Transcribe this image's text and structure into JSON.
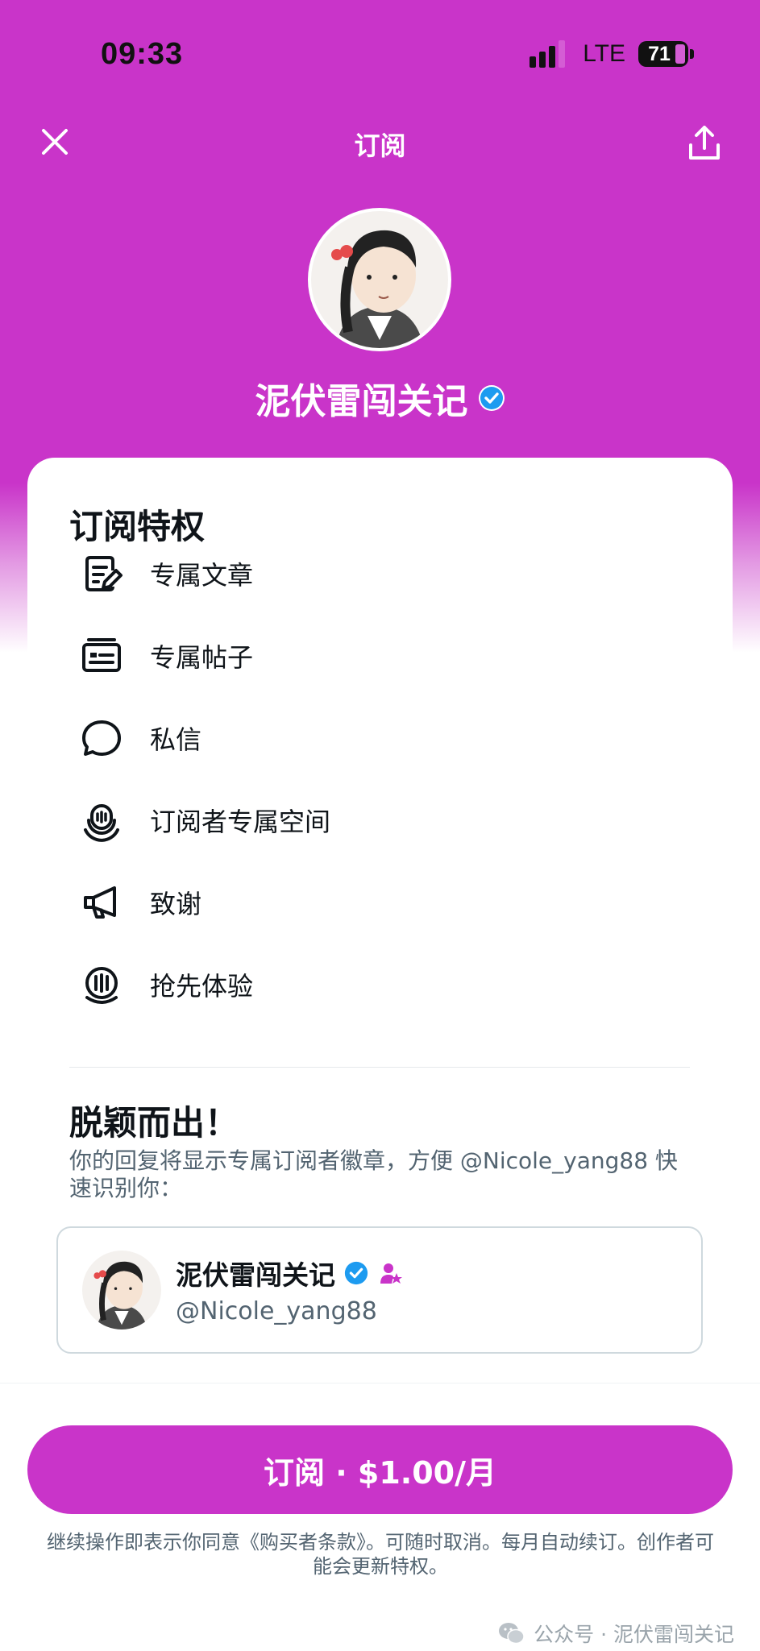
{
  "status_bar": {
    "time": "09:33",
    "network": "LTE",
    "battery": "71"
  },
  "nav": {
    "title": "订阅",
    "close_icon": "close-icon",
    "share_icon": "share-icon"
  },
  "profile": {
    "name": "泥伏雷闯关记",
    "verified": true
  },
  "perks_section": {
    "title": "订阅特权",
    "items": [
      {
        "label": "专属文章",
        "icon": "article-icon"
      },
      {
        "label": "专属帖子",
        "icon": "post-icon"
      },
      {
        "label": "私信",
        "icon": "message-icon"
      },
      {
        "label": "订阅者专属空间",
        "icon": "spaces-icon"
      },
      {
        "label": "致谢",
        "icon": "megaphone-icon"
      },
      {
        "label": "抢先体验",
        "icon": "early-access-icon"
      }
    ]
  },
  "stand_out": {
    "title": "脱颖而出！",
    "description": "你的回复将显示专属订阅者徽章，方便 @Nicole_yang88 快速识别你："
  },
  "preview": {
    "name": "泥伏雷闯关记",
    "handle": "@Nicole_yang88"
  },
  "cta": {
    "label": "订阅 · $1.00/月"
  },
  "terms": "继续操作即表示你同意《购买者条款》。可随时取消。每月自动续订。创作者可能会更新特权。",
  "watermark": "公众号 · 泥伏雷闯关记",
  "colors": {
    "brand": "#c934c9",
    "verified": "#1d9bf0",
    "text": "#0f1419",
    "secondary": "#536471"
  }
}
